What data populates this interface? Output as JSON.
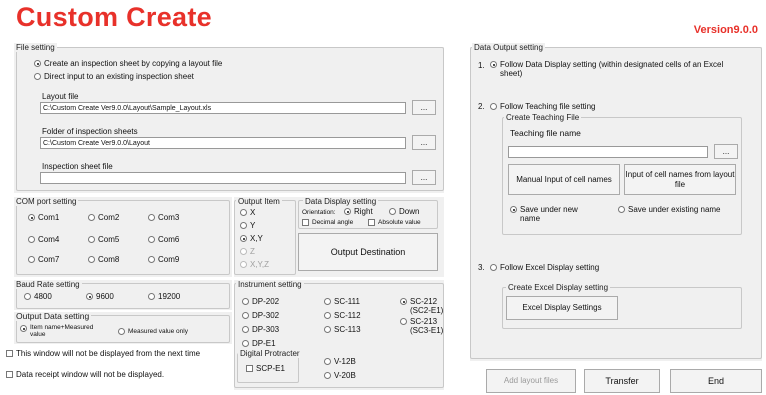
{
  "title": "Custom Create",
  "version": "Version9.0.0",
  "file_setting": {
    "label": "File setting",
    "opt_copy": "Create an inspection sheet by copying a layout file",
    "opt_direct": "Direct input to an existing inspection sheet",
    "layout_label": "Layout file",
    "layout_value": "C:\\Custom Create Ver9.0.0\\Layout\\Sample_Layout.xls",
    "folder_label": "Folder of inspection sheets",
    "folder_value": "C:\\Custom Create Ver9.0.0\\Layout",
    "sheet_label": "Inspection sheet file",
    "sheet_value": "",
    "browse": "..."
  },
  "com_port": {
    "label": "COM port setting",
    "ports": [
      "Com1",
      "Com2",
      "Com3",
      "Com4",
      "Com5",
      "Com6",
      "Com7",
      "Com8",
      "Com9"
    ],
    "selected": "Com1"
  },
  "output_item": {
    "label": "Output Item",
    "items": [
      "X",
      "Y",
      "X,Y",
      "Z",
      "X,Y,Z"
    ],
    "selected": "X,Y"
  },
  "display": {
    "label": "Data Display setting",
    "orientation": "Orientation:",
    "right": "Right",
    "down": "Down",
    "decimal": "Decimal angle",
    "absolute": "Absolute value"
  },
  "output_dest": "Output Destination",
  "baud": {
    "label": "Baud Rate setting",
    "rates": [
      "4800",
      "9600",
      "19200"
    ],
    "selected": "9600"
  },
  "out_data": {
    "label": "Output Data setting",
    "opt1": "Item name+Measured value",
    "opt2": "Measured value only"
  },
  "instrument": {
    "label": "Instrument setting",
    "col1": [
      "DP-202",
      "DP-302",
      "DP-303",
      "DP-E1"
    ],
    "col2": [
      "SC-111",
      "SC-112",
      "SC-113"
    ],
    "col3a": "SC-212 (SC2-E1)",
    "col3b": "SC-213 (SC3-E1)",
    "digital_label": "Digital Protracter",
    "scp": "SCP-E1",
    "v12": "V-12B",
    "v20": "V-20B"
  },
  "bottom": {
    "no_show": "This window will not be displayed from the next time",
    "no_receipt": "Data receipt window will not be displayed."
  },
  "data_output": {
    "label": "Data Output setting",
    "n1": "1.",
    "opt1": "Follow Data Display setting (within designated cells of an Excel sheet)",
    "n2": "2.",
    "opt2": "Follow Teaching file setting",
    "teach_label": "Create Teaching File",
    "teach_name": "Teaching file name",
    "teach_value": "",
    "manual": "Manual Input of cell names",
    "from_layout": "Input of cell names from layout file",
    "save_new": "Save under new name",
    "save_existing": "Save under existing name",
    "n3": "3.",
    "opt3": "Follow Excel Display setting",
    "excel_label": "Create Excel Display setting",
    "excel_btn": "Excel Display Settings"
  },
  "actions": {
    "add": "Add layout files",
    "transfer": "Transfer",
    "end": "End"
  },
  "colors": {
    "title": "#e8312a",
    "panel": "#f0f0f0",
    "border": "#c8c8c8"
  }
}
